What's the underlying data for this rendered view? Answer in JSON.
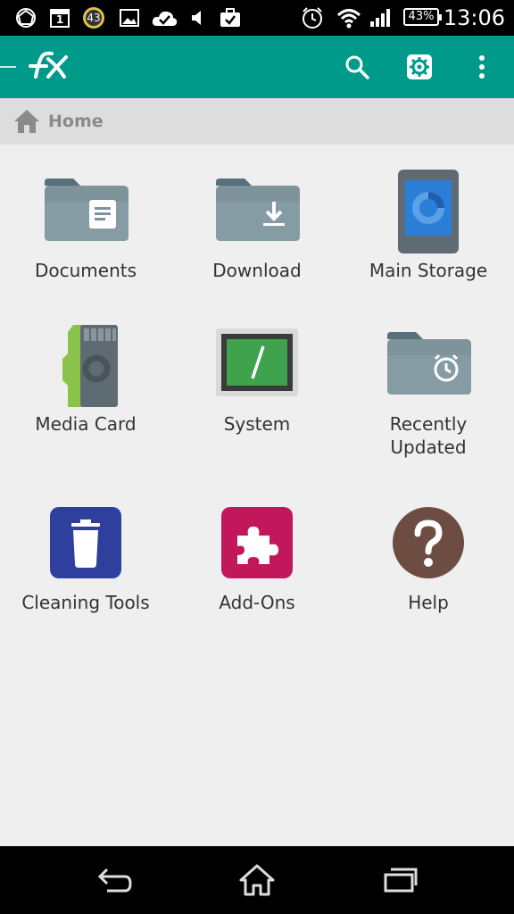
{
  "status_bar": {
    "calendar_day": "1",
    "notification_count": "43",
    "battery_percent": "43%",
    "time": "13:06",
    "icons": [
      "android-logo-icon",
      "calendar-icon",
      "badge-count-icon",
      "image-icon",
      "cloud-check-icon",
      "volume-icon",
      "briefcase-check-icon",
      "alarm-icon",
      "wifi-icon",
      "signal-icon",
      "battery-icon"
    ]
  },
  "app_bar": {
    "logo_icon": "fx-logo-icon",
    "actions": [
      "search-icon",
      "settings-icon",
      "more-vert-icon"
    ],
    "color": "#009a8b"
  },
  "breadcrumb": {
    "icon": "home-icon",
    "label": "Home"
  },
  "grid": {
    "items": [
      {
        "label": "Documents",
        "icon": "documents-folder-icon"
      },
      {
        "label": "Download",
        "icon": "download-folder-icon"
      },
      {
        "label": "Main Storage",
        "icon": "main-storage-icon"
      },
      {
        "label": "Media Card",
        "icon": "sd-card-icon"
      },
      {
        "label": "System",
        "icon": "terminal-icon"
      },
      {
        "label": "Recently\nUpdated",
        "icon": "recent-folder-icon"
      },
      {
        "label": "Cleaning Tools",
        "icon": "trash-icon"
      },
      {
        "label": "Add-Ons",
        "icon": "puzzle-icon"
      },
      {
        "label": "Help",
        "icon": "help-icon"
      }
    ]
  },
  "nav_bar": {
    "buttons": [
      "back-icon",
      "home-nav-icon",
      "recents-icon"
    ]
  }
}
